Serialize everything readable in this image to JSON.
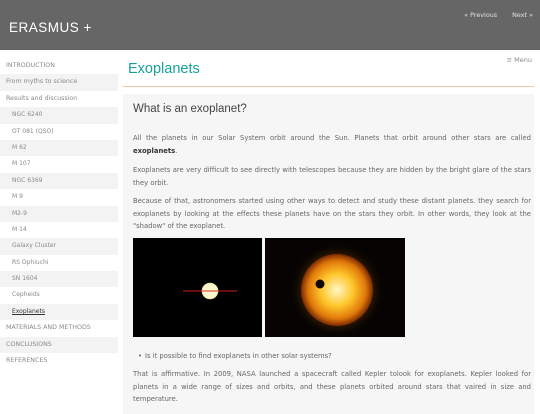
{
  "header": {
    "brand": "ERASMUS +",
    "prev_label": "« Previous",
    "next_label": "Next »"
  },
  "sidebar": {
    "items": [
      {
        "label": "INTRODUCTION"
      },
      {
        "label": "From myths to science"
      },
      {
        "label": "Results and discussion"
      },
      {
        "label": "NGC 6240"
      },
      {
        "label": "OT 081 (QSO)"
      },
      {
        "label": "M 62"
      },
      {
        "label": "M 107"
      },
      {
        "label": "NGC 6369"
      },
      {
        "label": "M 9"
      },
      {
        "label": "M2-9"
      },
      {
        "label": "M 14"
      },
      {
        "label": "Galaxy Cluster"
      },
      {
        "label": "RS Ophiuchi"
      },
      {
        "label": "SN 1604"
      },
      {
        "label": "Cepheids"
      },
      {
        "label": "Exoplanets"
      },
      {
        "label": "MATERIALS AND METHODS"
      },
      {
        "label": "CONCLUSIONS"
      },
      {
        "label": "REFERENCES"
      }
    ]
  },
  "menu_label": "≡ Menu",
  "page_title": "Exoplanets",
  "section": {
    "title": "What is an exoplanet?",
    "p1_text": "All the planets in our Solar System orbit around the Sun. Planets that orbit around other stars are called ",
    "p1_bold": "exoplanets",
    "p1_end": ".",
    "p2": "Exoplanets are very difficult to see directly with telescopes because they are hidden by the bright glare of the stars they orbit.",
    "p3": "Because of that, astronomers started using other ways to detect and study these distant planets. they search for exoplanets by looking at the effects these planets have on the stars they orbit. In other words, they look at the \"shadow\" of the exoplanet.",
    "bullet": "Is it possible to find exoplanets in other solar systems?",
    "p4": "That is affirmative. In 2009, NASA launched a spacecraft called Kepler tolook for exoplanets. Kepler looked for planets in a wide range of sizes and orbits, and these planets orbited around stars that vaired in size and temperature."
  },
  "colors": {
    "header_bg": "#666666",
    "accent_teal": "#15a39a",
    "rule": "#e8c9a4",
    "content_bg": "#f6f6f6"
  }
}
